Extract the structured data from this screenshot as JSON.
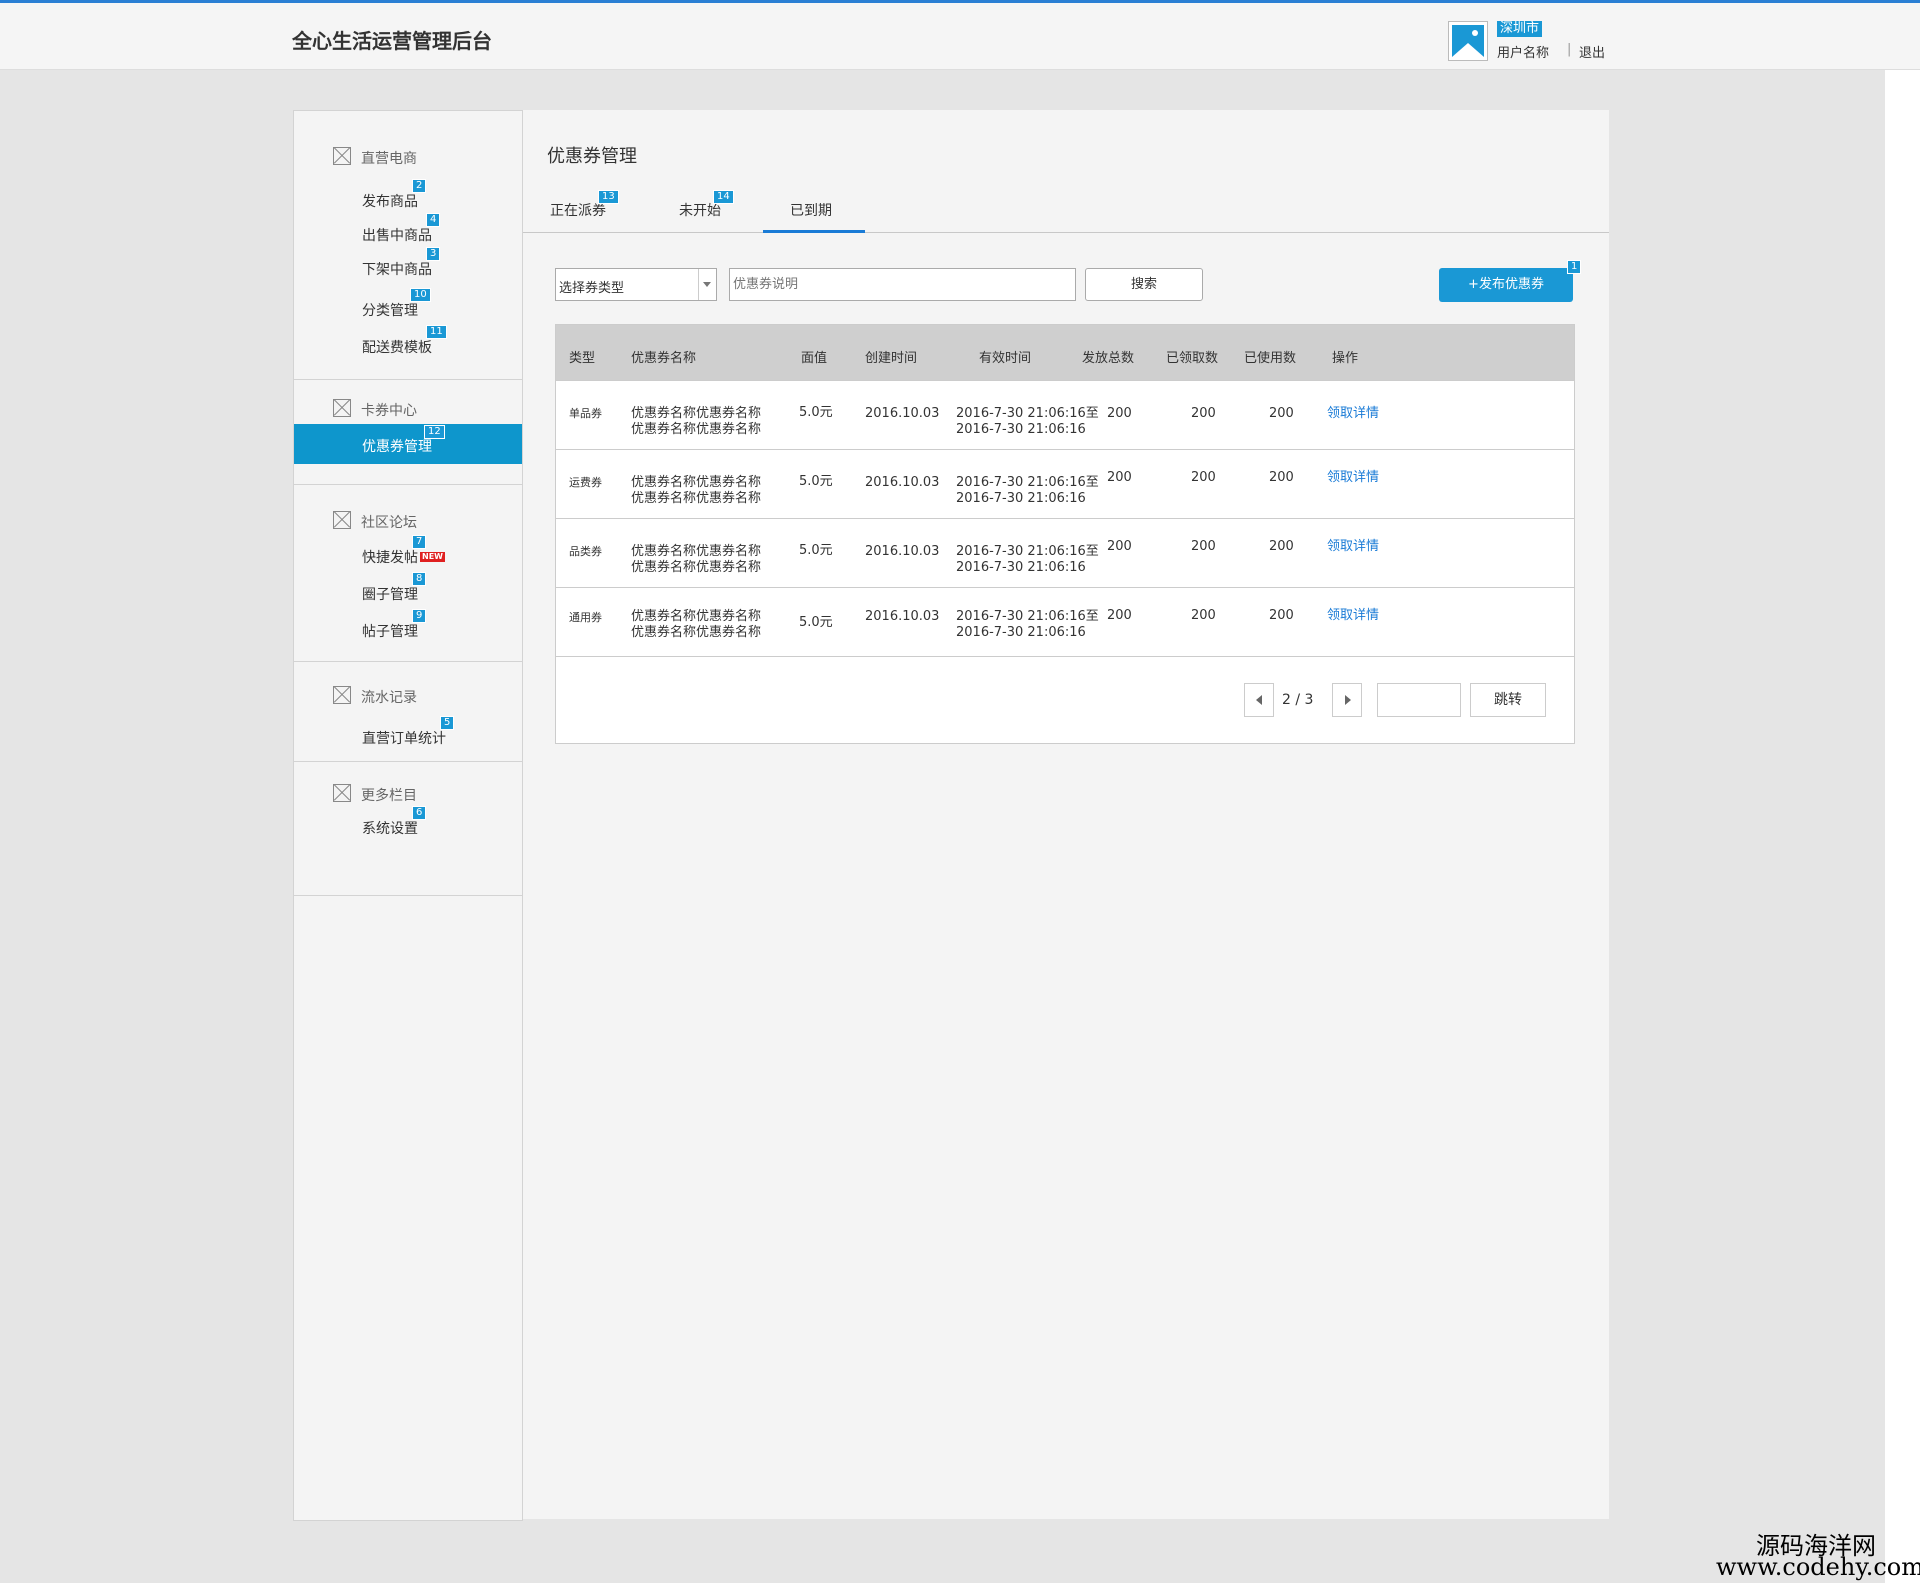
{
  "header": {
    "app_title": "全心生活运营管理后台",
    "city": "深圳市",
    "username": "用户名称",
    "separator": "|",
    "logout": "退出"
  },
  "sidebar": {
    "sections": [
      {
        "title": "直营电商",
        "items": [
          {
            "label": "发布商品",
            "badge": "2"
          },
          {
            "label": "出售中商品",
            "badge": "4"
          },
          {
            "label": "下架中商品",
            "badge": "3"
          },
          {
            "label": "分类管理",
            "badge": "10"
          },
          {
            "label": "配送费模板",
            "badge": "11"
          }
        ]
      },
      {
        "title": "卡券中心",
        "items": [
          {
            "label": "优惠券管理",
            "badge": "12",
            "active": true
          }
        ]
      },
      {
        "title": "社区论坛",
        "items": [
          {
            "label": "快捷发帖",
            "badge": "7",
            "tag": "NEW"
          },
          {
            "label": "圈子管理",
            "badge": "8"
          },
          {
            "label": "帖子管理",
            "badge": "9"
          }
        ]
      },
      {
        "title": "流水记录",
        "items": [
          {
            "label": "直营订单统计",
            "badge": "5"
          }
        ]
      },
      {
        "title": "更多栏目",
        "items": [
          {
            "label": "系统设置",
            "badge": "6"
          }
        ]
      }
    ]
  },
  "main": {
    "page_title": "优惠券管理",
    "tabs": [
      {
        "label": "正在派券",
        "badge": "13"
      },
      {
        "label": "未开始",
        "badge": "14"
      },
      {
        "label": "已到期",
        "active": true
      }
    ],
    "filter": {
      "select_value": "选择券类型",
      "desc_placeholder": "优惠券说明",
      "search_label": "搜索",
      "publish_label": "+发布优惠券",
      "publish_badge": "1"
    },
    "table": {
      "headers": [
        "类型",
        "优惠券名称",
        "面值",
        "创建时间",
        "有效时间",
        "发放总数",
        "已领取数",
        "已使用数",
        "操作"
      ],
      "rows": [
        {
          "type": "单品券",
          "name1": "优惠券名称优惠券名称",
          "name2": "优惠券名称优惠券名称",
          "value": "5.0元",
          "created": "2016.10.03",
          "valid1": "2016-7-30 21:06:16至",
          "valid2": "2016-7-30 21:06:16",
          "total": "200",
          "received": "200",
          "used": "200",
          "action": "领取详情"
        },
        {
          "type": "运费券",
          "name1": "优惠券名称优惠券名称",
          "name2": "优惠券名称优惠券名称",
          "value": "5.0元",
          "created": "2016.10.03",
          "valid1": "2016-7-30 21:06:16至",
          "valid2": "2016-7-30 21:06:16",
          "total": "200",
          "received": "200",
          "used": "200",
          "action": "领取详情"
        },
        {
          "type": "品类券",
          "name1": "优惠券名称优惠券名称",
          "name2": "优惠券名称优惠券名称",
          "value": "5.0元",
          "created": "2016.10.03",
          "valid1": "2016-7-30 21:06:16至",
          "valid2": "2016-7-30 21:06:16",
          "total": "200",
          "received": "200",
          "used": "200",
          "action": "领取详情"
        },
        {
          "type": "通用券",
          "name1": "优惠券名称优惠券名称",
          "name2": "优惠券名称优惠券名称",
          "value": "5.0元",
          "created": "2016.10.03",
          "valid1": "2016-7-30 21:06:16至",
          "valid2": "2016-7-30 21:06:16",
          "total": "200",
          "received": "200",
          "used": "200",
          "action": "领取详情"
        }
      ]
    },
    "pagination": {
      "text": "2 / 3",
      "jump_label": "跳转"
    }
  },
  "watermark": {
    "line1": "源码海洋网",
    "line2": "www.codehy.com"
  },
  "colors": {
    "accent": "#1a98d5",
    "active_nav": "#0e96cc",
    "link": "#1a7bd6",
    "top_line": "#2a7fd4",
    "new_tag": "#e02020"
  },
  "icons": [
    "image-placeholder-icon",
    "avatar-image-icon",
    "dropdown-arrow-icon",
    "prev-page-icon",
    "next-page-icon"
  ]
}
